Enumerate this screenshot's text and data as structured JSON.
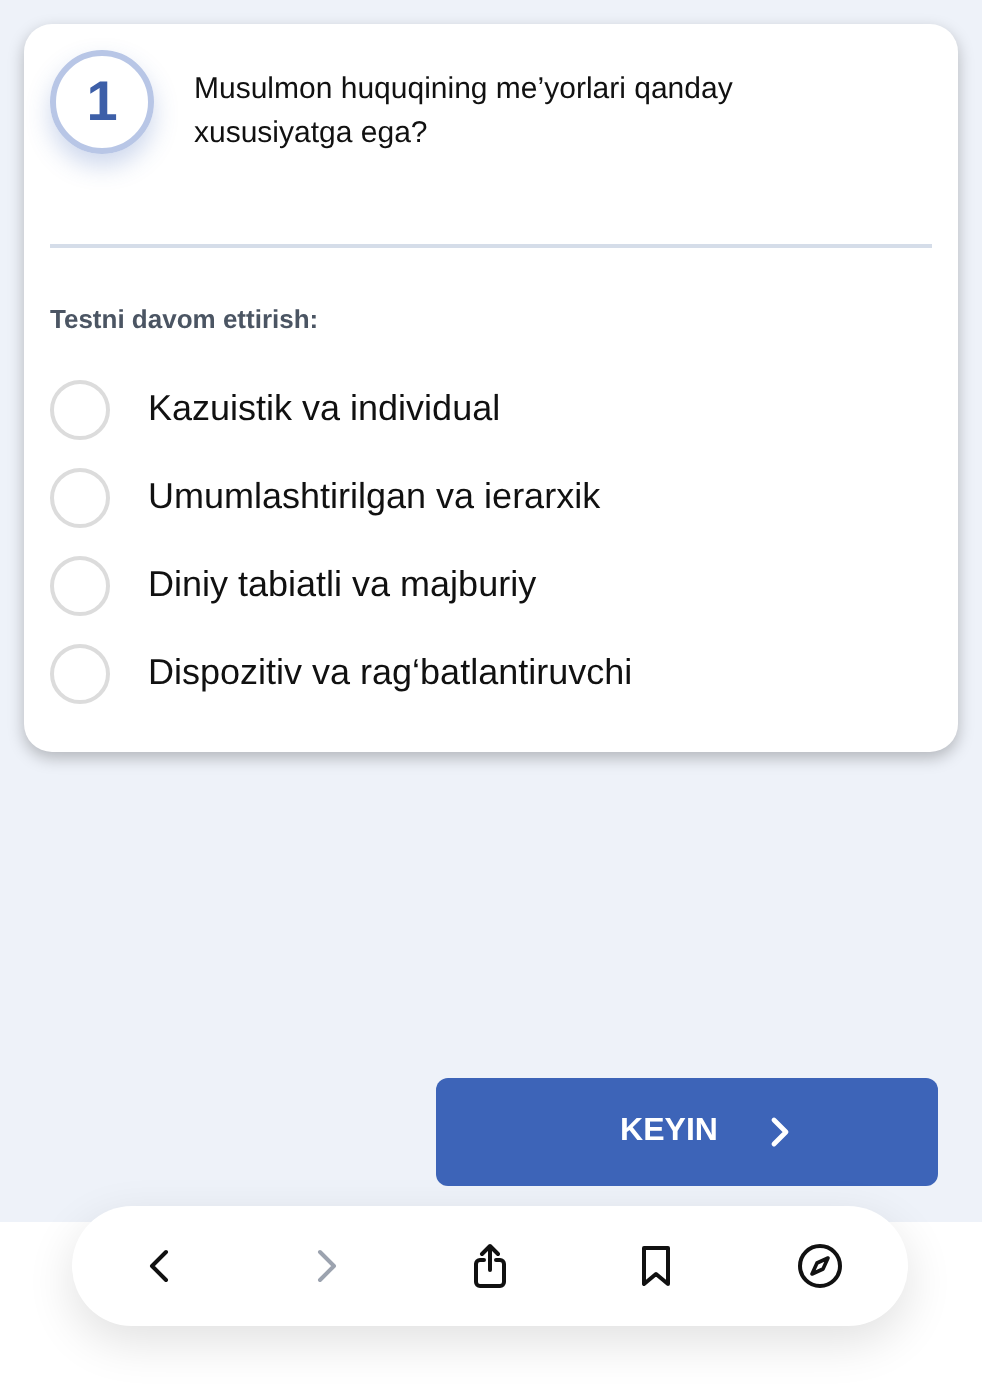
{
  "question": {
    "number": "1",
    "text": "Musulmon huquqining me’yorlari qanday xususiyatga ega?"
  },
  "section_label": "Testni davom ettirish:",
  "options": [
    {
      "label": "Kazuistik va individual",
      "selected": false
    },
    {
      "label": "Umumlashtirilgan va ierarxik",
      "selected": false
    },
    {
      "label": "Diniy tabiatli va majburiy",
      "selected": false
    },
    {
      "label": "Dispozitiv va rag‘batlantiruvchi",
      "selected": false
    }
  ],
  "next_button": {
    "label": "KEYIN"
  },
  "browser_toolbar": [
    {
      "kind": "back",
      "disabled": false
    },
    {
      "kind": "forward",
      "disabled": true
    },
    {
      "kind": "share",
      "disabled": false
    },
    {
      "kind": "bookmarks",
      "disabled": false
    },
    {
      "kind": "compass",
      "disabled": false
    }
  ]
}
